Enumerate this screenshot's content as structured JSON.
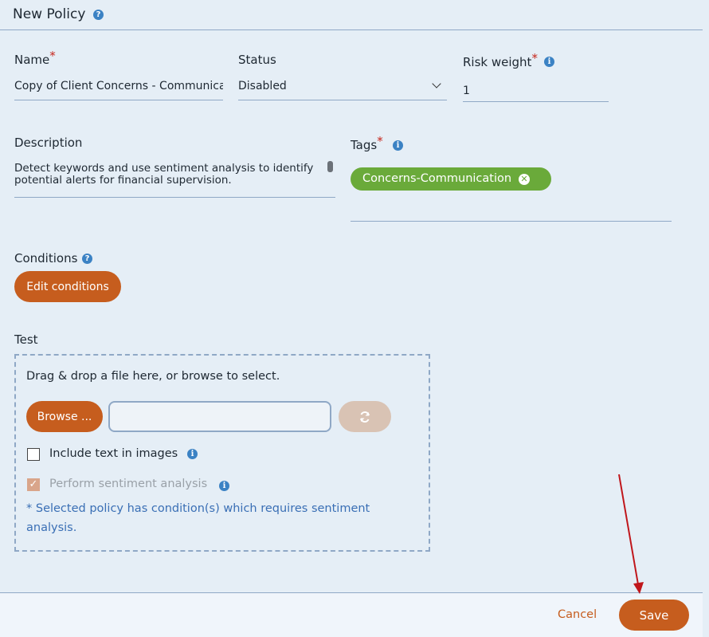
{
  "header": {
    "title": "New Policy"
  },
  "name": {
    "label": "Name",
    "required_mark": "*",
    "value": "Copy of Client Concerns - Communications"
  },
  "status": {
    "label": "Status",
    "value": "Disabled"
  },
  "risk_weight": {
    "label": "Risk weight",
    "required_mark": "*",
    "value": "1"
  },
  "description": {
    "label": "Description",
    "value": "Detect keywords and use sentiment analysis to identify potential alerts for financial supervision."
  },
  "tags": {
    "label": "Tags",
    "required_mark": "*",
    "items": [
      {
        "label": "Concerns-Communication"
      }
    ]
  },
  "conditions": {
    "label": "Conditions",
    "edit_button": "Edit conditions"
  },
  "test": {
    "label": "Test",
    "drop_hint": "Drag & drop a file here, or browse to select.",
    "browse_button": "Browse ...",
    "file_value": "",
    "include_text_label": "Include text in images",
    "include_text_checked": false,
    "sentiment_label": "Perform sentiment analysis",
    "sentiment_checked": true,
    "note": "* Selected policy has condition(s) which requires sentiment analysis."
  },
  "footer": {
    "cancel": "Cancel",
    "save": "Save"
  },
  "colors": {
    "accent": "#c65d1e",
    "tag": "#6aaa3a",
    "info": "#3b82c4",
    "annotation_arrow": "#c0161b"
  },
  "icons": [
    "help-icon",
    "info-icon",
    "chevron-down-icon",
    "remove-tag-icon",
    "refresh-icon",
    "check-icon",
    "annotation-arrow"
  ]
}
